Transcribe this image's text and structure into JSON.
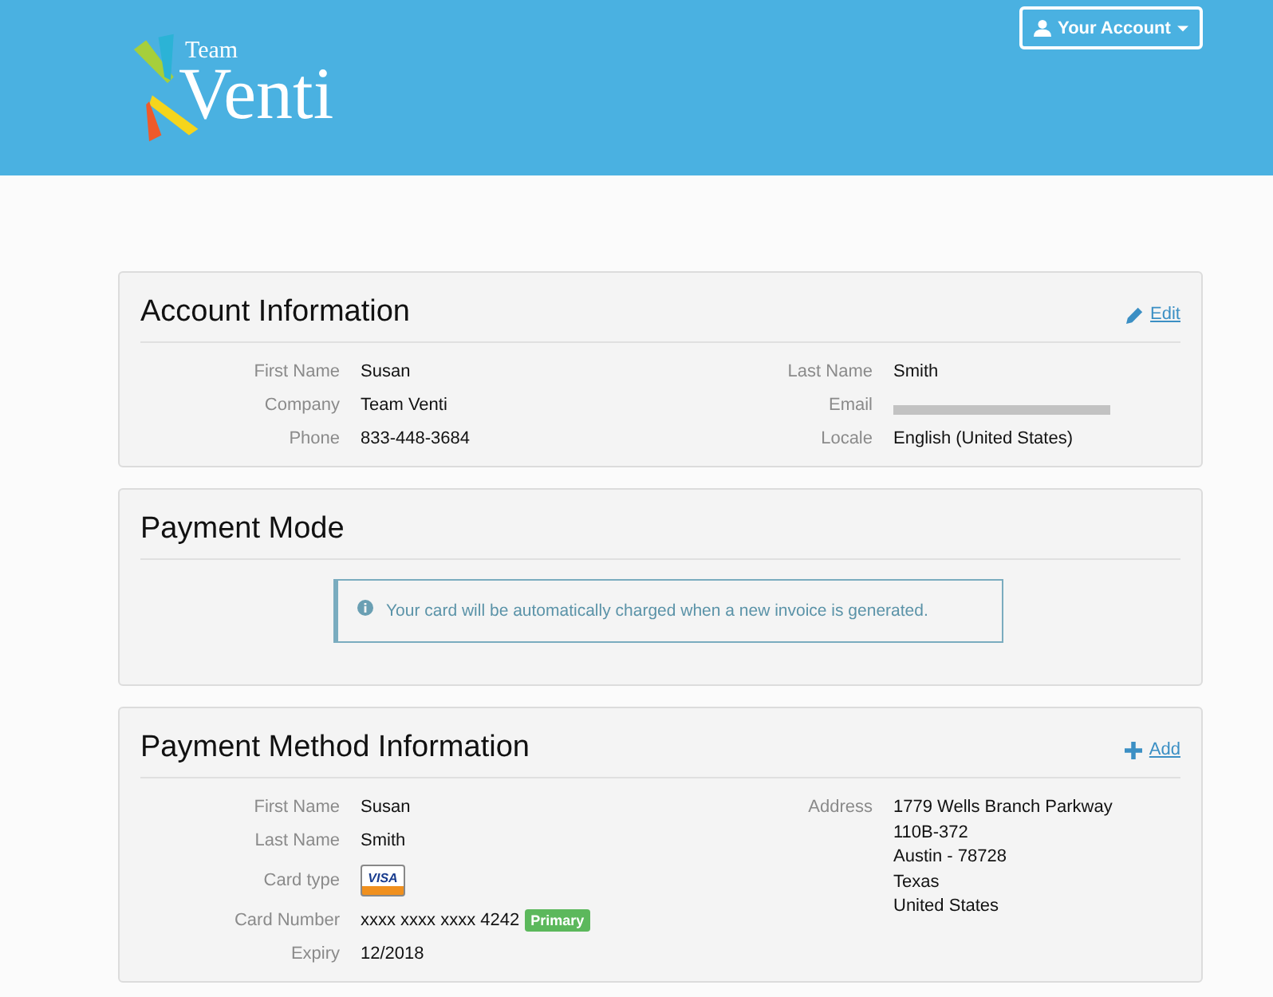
{
  "header": {
    "logo": {
      "small": "Team",
      "large": "Venti"
    },
    "account_button": "Your Account"
  },
  "account_information": {
    "title": "Account Information",
    "action": {
      "kind": "edit",
      "label": "Edit"
    },
    "rows": [
      {
        "label": "First Name",
        "value": "Susan",
        "label_2": "Last Name",
        "value_2": "Smith"
      },
      {
        "label": "Company",
        "value": "Team Venti",
        "label_2": "Email",
        "redacted_2": true
      },
      {
        "label": "Phone",
        "value": "833-448-3684",
        "label_2": "Locale",
        "value_2": "English (United States)"
      }
    ]
  },
  "payment_mode": {
    "title": "Payment Mode",
    "notice": "Your card will be automatically charged when a new invoice is generated."
  },
  "payment_method": {
    "title": "Payment Method Information",
    "action": {
      "kind": "add",
      "label": "Add"
    },
    "fields": [
      {
        "kind": "text",
        "label": "First Name",
        "value": "Susan"
      },
      {
        "kind": "text",
        "label": "Last Name",
        "value": "Smith"
      },
      {
        "kind": "card",
        "label": "Card type",
        "value": "VISA"
      },
      {
        "kind": "number",
        "label": "Card Number",
        "value": "xxxx xxxx xxxx 4242",
        "badge": "Primary"
      },
      {
        "kind": "text",
        "label": "Expiry",
        "value": "12/2018"
      }
    ],
    "address": {
      "label": "Address",
      "lines": [
        "1779 Wells Branch Parkway",
        "110B-372",
        "Austin - 78728",
        "Texas",
        "United States"
      ]
    }
  }
}
